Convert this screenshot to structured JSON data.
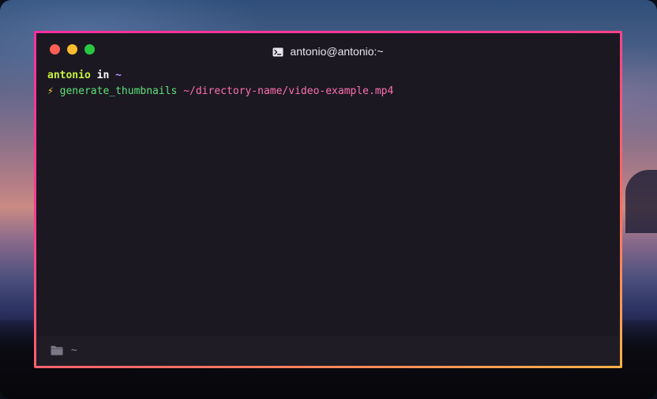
{
  "window": {
    "title": "antonio@antonio:~"
  },
  "terminal": {
    "prompt": {
      "user": "antonio",
      "in": "in",
      "cwd": "~"
    },
    "command_line": {
      "bolt": "⚡",
      "command": "generate_thumbnails",
      "argument": "~/directory-name/video-example.mp4"
    }
  },
  "statusbar": {
    "path": "~"
  },
  "colors": {
    "frame_gradient": [
      "#ff2fa0",
      "#ff6d63",
      "#ffb24a"
    ],
    "window_bg": "#1b1821",
    "user": "#c8f23c",
    "cwd": "#b895ff",
    "command": "#5ee27a",
    "argument": "#ff6fb1"
  },
  "icons": {
    "title": "terminal-icon",
    "status": "folder-icon"
  }
}
